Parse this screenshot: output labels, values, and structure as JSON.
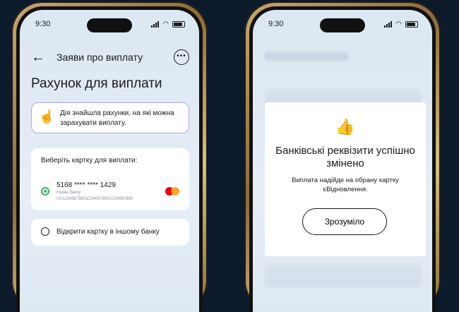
{
  "left_phone": {
    "status": {
      "time": "9:30"
    },
    "nav": {
      "back_icon": "arrow-left-icon",
      "title": "Заяви про виплату",
      "more_icon": "more-horizontal-icon"
    },
    "page_title": "Рахунок для виплати",
    "info_box": {
      "emoji": "☝️",
      "text": "Дія знайшла рахунки, на які можна зарахувати виплату."
    },
    "card_select": {
      "label": "Виберіть картку для виплати:",
      "card_number": "5168 **** **** 1429",
      "bank_name": "Назва банку",
      "iban": "UA123456789012345678901234567890",
      "selected": true
    },
    "other_bank": {
      "label": "Відкрити картку в іншому банку",
      "selected": false
    }
  },
  "right_phone": {
    "status": {
      "time": "9:30"
    },
    "dialog": {
      "emoji": "👍",
      "title": "Банківські реквізити успішно змінено",
      "message": "Виплата надійде на обрану картку єВідновлення.",
      "button": "Зрозуміло"
    }
  },
  "colors": {
    "background": "#0d1a2b",
    "radio_selected": "#3bb060",
    "info_border": "#b8a3e0"
  }
}
